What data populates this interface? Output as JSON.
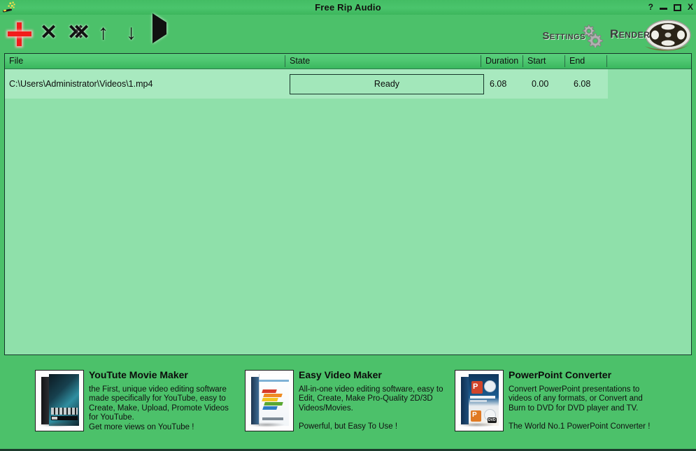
{
  "window": {
    "title": "Free Rip Audio",
    "app_icon": "magic-wand-icon",
    "controls": {
      "help": "?",
      "minimize": "–",
      "maximize": "□",
      "close": "X"
    }
  },
  "toolbar": {
    "add_label": "+",
    "delete_label": "✕",
    "delete_all_label": "✕",
    "move_up_label": "↑",
    "move_down_label": "↓",
    "play_label": "▶",
    "settings_label": "Settings",
    "render_label": "Render"
  },
  "file_list": {
    "columns": [
      {
        "key": "file",
        "label": "File"
      },
      {
        "key": "state",
        "label": "State"
      },
      {
        "key": "duration",
        "label": "Duration"
      },
      {
        "key": "start",
        "label": "Start"
      },
      {
        "key": "end",
        "label": "End"
      }
    ],
    "rows": [
      {
        "file": "C:\\Users\\Administrator\\Videos\\1.mp4",
        "state": "Ready",
        "duration": "6.08",
        "start": "0.00",
        "end": "6.08"
      }
    ]
  },
  "ads": [
    {
      "title": "YouTute Movie Maker",
      "description": "the First, unique video editing software\nmade specifically for YouTube, easy to\nCreate, Make, Upload, Promote Videos\nfor YouTube.",
      "tagline": "Get more views on YouTube !",
      "thumb": "youtube-movie-maker-box-icon"
    },
    {
      "title": "Easy Video Maker",
      "description": "All-in-one video editing software, easy to\nEdit, Create, Make Pro-Quality 2D/3D\nVideos/Movies.",
      "tagline": "Powerful, but Easy To Use !",
      "thumb": "easy-video-maker-box-icon"
    },
    {
      "title": "PowerPoint Converter",
      "description": "Convert PowerPoint presentations to\nvideos of any formats, or Convert and\nBurn to DVD for DVD player and TV.",
      "tagline": "The World No.1 PowerPoint Converter !",
      "thumb": "powerpoint-converter-box-icon"
    }
  ],
  "colors": {
    "window_green": "#4cc16a",
    "titlebar_green": "#43bd64",
    "header_green": "#4fc772",
    "row_green": "#a8e9bf",
    "empty_green": "#8fe0aa",
    "add_red": "#f21b1b",
    "border_dark": "#15362a"
  }
}
